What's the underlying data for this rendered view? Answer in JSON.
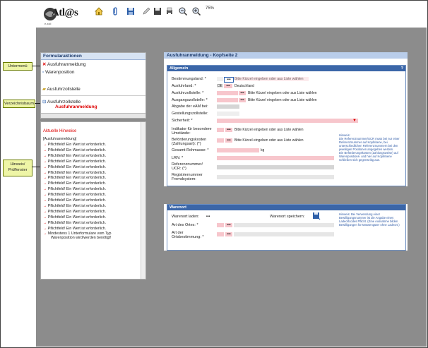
{
  "app": {
    "logo_text": "Atl@s",
    "logo_sub": "e.zoll",
    "zoom": "75%"
  },
  "toolbar": [
    "home-icon",
    "paperclip-icon",
    "save-icon",
    "pencil-icon",
    "save-as-icon",
    "print-icon",
    "zoom-out-icon",
    "zoom-in-icon"
  ],
  "callouts": {
    "submenu": "Untermenü",
    "tree": "Verzeichnisbaum",
    "hints": "Hinweis/\nPrüffenster"
  },
  "formactions": {
    "title": "Formularaktionen",
    "items": [
      "Ausfuhranmeldung",
      "Warenposition",
      "Ausfuhrzollstelle"
    ],
    "tree_parent": "Ausfuhrzollstelle",
    "tree_child": "Ausfuhranmeldung"
  },
  "hints": {
    "title": "Aktuelle Hinweise",
    "context": "[Ausfuhranmeldung]",
    "lines": [
      "Pflichtfeld! Ein Wert ist erforderlich.",
      "Pflichtfeld! Ein Wert ist erforderlich.",
      "Pflichtfeld! Ein Wert ist erforderlich.",
      "Pflichtfeld! Ein Wert ist erforderlich.",
      "Pflichtfeld! Ein Wert ist erforderlich.",
      "Pflichtfeld! Ein Wert ist erforderlich.",
      "Pflichtfeld! Ein Wert ist erforderlich.",
      "Pflichtfeld! Ein Wert ist erforderlich.",
      "Pflichtfeld! Ein Wert ist erforderlich.",
      "Pflichtfeld! Ein Wert ist erforderlich.",
      "Pflichtfeld! Ein Wert ist erforderlich.",
      "Pflichtfeld! Ein Wert ist erforderlich.",
      "Pflichtfeld! Ein Wert ist erforderlich.",
      "Pflichtfeld! Ein Wert ist erforderlich.",
      "Pflichtfeld! Ein Wert ist erforderlich.",
      "Pflichtfeld! Ein Wert ist erforderlich."
    ],
    "last_line_1": "Mindestens 1 Unterformulare vom Typ",
    "last_line_2": "Warenposition wird/werden benötigt!"
  },
  "form": {
    "title": "Ausfuhranmeldung - Kopfseite 2",
    "section1": "Allgemein",
    "help": "?",
    "fields": {
      "bestimmungsland": "Bestimmungsland: *",
      "ausfuhrland": "Ausfuhrland: *",
      "ausfuhrzollstelle": "Ausfuhrzollstelle: *",
      "ausgangszollstelle": "Ausgangszollstelle: *",
      "abgabe": "Abgabe der eAM bei:",
      "gestellung": "Gestellungszollstelle:",
      "sicherheit": "Sicherheit: *",
      "indikator_1": "Indikator für besondere",
      "indikator_2": "Umstände:",
      "befoerderung_1": "Beförderungskosten",
      "befoerderung_2": "(Zahlungsart): (*)",
      "rohmasse": "Gesamt-Rohmasse: *",
      "lrn": "LRN: *",
      "ucr_1": "Referenznummer/",
      "ucr_2": "UCR: (*)",
      "reg_1": "Registriernummer",
      "reg_2": "Fremdsystem:"
    },
    "picker_hint": "Bitte Kürzel eingeben oder aus Liste wählen",
    "dots": "•••",
    "de_code": "DE",
    "de_name": "Deutschland",
    "kg": "kg",
    "note": "Hinweis:\nDie Referenznummer/UCR muss bei nur einer Referenznummer auf Kopfebene, bei unterschiedlichen Referenznummern bei den jeweiligen Positionen angegeben werden.\nDie Beförderungskosten (Zahlungsweise) auf Warenpositions- und hier auf Kopfebene schließen sich gegenseitig aus.",
    "section2": "Warenort",
    "warenort_laden": "Warenort laden:",
    "warenort_speichern": "Warenort speichern:",
    "art_ortes": "Art des Ortes: *",
    "art_bestimmung_1": "Art der",
    "art_bestimmung_2": "Ortsbestimmung: *",
    "note2": "Hinweis:  Bei Verwendung einer Bewilligungsnummer ist die Angabe eines Ladeortcodes Pflicht. (Eine Ausnahme bilden Bewilligungen für Massengüter ohne Ladeort.)"
  }
}
